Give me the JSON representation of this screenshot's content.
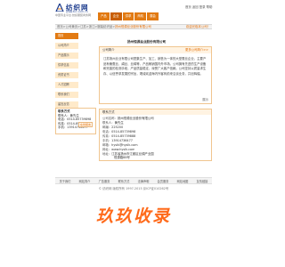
{
  "header": {
    "logo_title": "纺织网",
    "logo_domain": "www.tnc.com.cn",
    "slogan": "中国专业平台·纺织服装商务网",
    "top_links": "首页  返回  登录  帮助",
    "nav_tabs": [
      "产品",
      "企业",
      "供求",
      "商机",
      "展会"
    ]
  },
  "breadcrumb": {
    "path": "首页>公司黄页>江苏>浙江>服装纺织品>",
    "company": "扬州恒源丝业股份有限公司",
    "right_text": "欢迎光临本公司！"
  },
  "sidebar": {
    "items": [
      "首页",
      "公司简介",
      "产品展示",
      "供求信息",
      "资质证书",
      "人才招聘",
      "联系我们",
      "留言反馈"
    ]
  },
  "contact_box": {
    "title": "联系方式",
    "lines": [
      "联系人：黄先生",
      "电话：0514-85739898",
      "传真：0514-85739888",
      "手机：13914736477"
    ],
    "button": "在线留言"
  },
  "intro": {
    "company_name": "扬州恒源丝业股份有限公司",
    "panel_title": "公司简介",
    "more": "更多公司简介>>",
    "body": "江苏扬州丝业有限公司是集生产、加工、销售为一体的大型蚕丝企业，主要产品有桑蚕丝、绢丝、丝绵等，产品畅销国内外市场。公司拥有先进的生产设备和完善的检测手段，产品质量稳定，深受广大客户信赖。公司坚持以质量求生存、以信誉求发展的宗旨，竭诚欢迎海内外客商前来洽谈业务，共创辉煌。",
    "end_mark": "展示"
  },
  "details": {
    "title": "联系方式",
    "rows": [
      {
        "label": "公司名称：",
        "value": "扬州恒源丝业股份有限公司"
      },
      {
        "label": "联系人：",
        "value": "黄先生"
      },
      {
        "label": "邮编：",
        "value": "225200"
      },
      {
        "label": "电话：",
        "value": "0514-85739898"
      },
      {
        "label": "传真：",
        "value": "0514-85739888"
      },
      {
        "label": "手机：",
        "value": "13914736477"
      },
      {
        "label": "邮箱：",
        "value": "hyslk@hyslk.com"
      },
      {
        "label": "网址：",
        "value": "www.hyslk.com"
      },
      {
        "label": "地址：",
        "value": "江苏省扬州市江都区丝绸产业园"
      },
      {
        "label": "",
        "value": "恒源路88号"
      }
    ]
  },
  "footer": {
    "links": [
      "关于我们",
      "网站简介",
      "广告服务",
      "联系方式",
      "法律声明",
      "会员服务",
      "网站地图",
      "友情链接"
    ],
    "copyright": "© 纺织网 版权所有 1997-2015  京ICP证010262号"
  },
  "watermark": {
    "text": "玖玖收录",
    "color": "#ff6a1a"
  }
}
